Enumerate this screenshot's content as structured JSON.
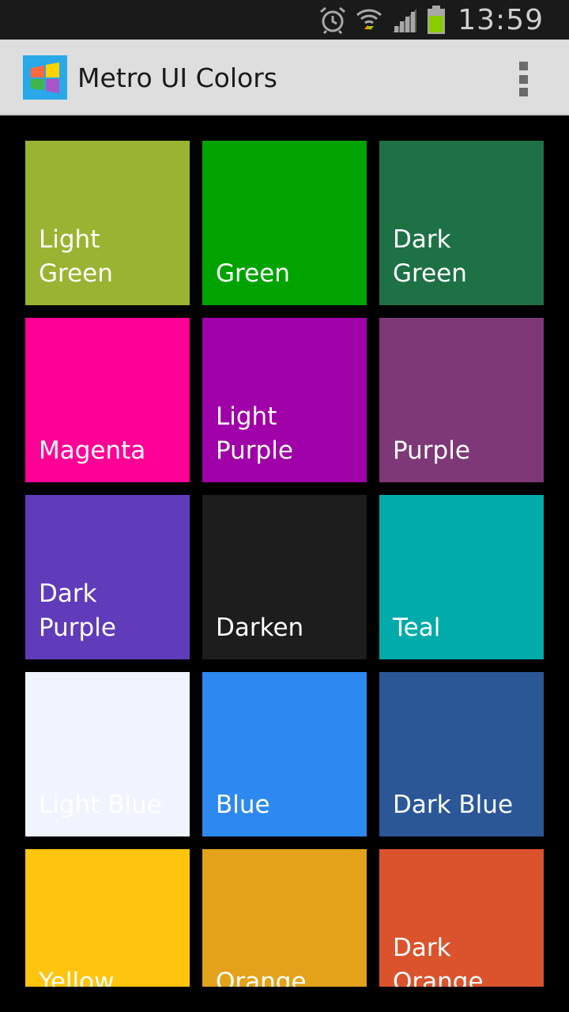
{
  "status_bar": {
    "time": "13:59",
    "icons": [
      "alarm-clock-icon",
      "wifi-icon",
      "signal-icon",
      "battery-icon"
    ]
  },
  "action_bar": {
    "title": "Metro UI Colors",
    "app_icon": "windows-logo-icon",
    "menu_icon": "overflow-menu-icon"
  },
  "tiles": [
    {
      "label": "Light\nGreen",
      "color": "#99b433"
    },
    {
      "label": "Green",
      "color": "#00a300"
    },
    {
      "label": "Dark\nGreen",
      "color": "#1e7145"
    },
    {
      "label": "Magenta",
      "color": "#ff0097"
    },
    {
      "label": "Light\nPurple",
      "color": "#9f00a7"
    },
    {
      "label": "Purple",
      "color": "#7e3878"
    },
    {
      "label": "Dark\nPurple",
      "color": "#603cba"
    },
    {
      "label": "Darken",
      "color": "#1d1d1d"
    },
    {
      "label": "Teal",
      "color": "#00aba9"
    },
    {
      "label": "Light Blue",
      "color": "#eff4ff"
    },
    {
      "label": "Blue",
      "color": "#2d89ef"
    },
    {
      "label": "Dark Blue",
      "color": "#2b5797"
    },
    {
      "label": "Yellow",
      "color": "#ffc40d"
    },
    {
      "label": "Orange",
      "color": "#e3a21a"
    },
    {
      "label": "Dark\nOrange",
      "color": "#da532c"
    }
  ]
}
